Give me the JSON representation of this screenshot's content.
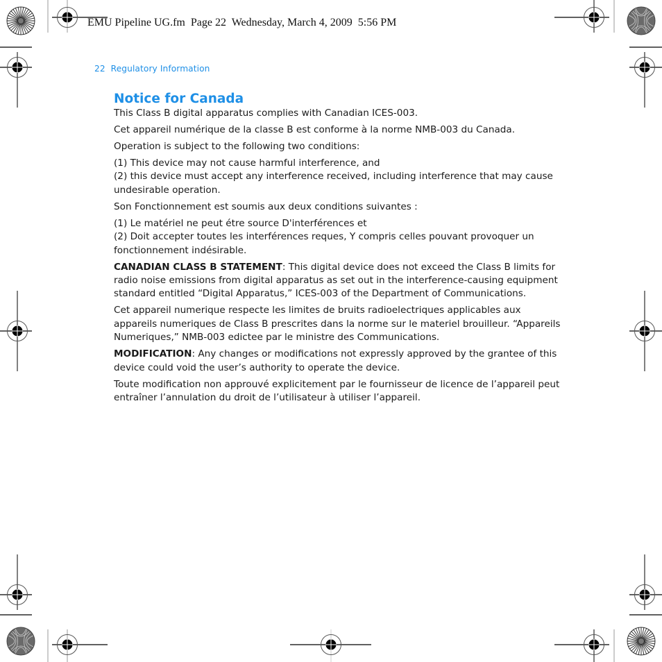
{
  "slug": {
    "text": "EMU Pipeline UG.fm  Page 22  Wednesday, March 4, 2009  5:56 PM"
  },
  "running_head": {
    "page_number": "22",
    "section": "Regulatory Information"
  },
  "section": {
    "title": "Notice for Canada",
    "title_color": "#1e8fe6",
    "paragraphs": [
      {
        "text": "This Class B digital apparatus complies with Canadian ICES-003."
      },
      {
        "text": "Cet appareil numérique de la classe B est conforme à la norme NMB-003 du Canada."
      },
      {
        "text": "Operation is subject to the following two conditions:"
      },
      {
        "line1": "(1) This device may not cause harmful interference, and",
        "line2": "(2) this device must accept any interference received, including interference that may cause undesirable operation."
      },
      {
        "text": "Son Fonctionnement  est  soumis aux deux conditions suivantes :"
      },
      {
        "line1": "(1) Le matériel ne peut étre source D'interférences et",
        "line2": "(2) Doit accepter toutes les interférences reques, Y compris celles pouvant provoquer un fonctionnement indésirable."
      },
      {
        "lead": "CANADIAN CLASS B STATEMENT",
        "text": ": This digital device does not exceed the Class B limits for radio noise emissions from digital apparatus as set out in the interference-causing equipment standard entitled “Digital Apparatus,” ICES-003 of the Department of Communications."
      },
      {
        "text": "Cet appareil numerique respecte les limites de bruits radioelectriques applicables aux appareils numeriques de Class B prescrites dans la norme sur le materiel brouilleur. “Appareils Numeriques,” NMB-003 edictee par le ministre des Communications."
      },
      {
        "lead": "MODIFICATION",
        "text": ": Any changes or modifications not expressly approved by the grantee of this device could void the user’s authority to operate the device."
      },
      {
        "text": "Toute modification non approuvé explicitement par le fournisseur de licence de l’appareil peut entraîner l’annulation du droit de l’utilisateur à utiliser l’appareil."
      }
    ]
  },
  "print_marks": {
    "registration_mark_icon": "crosshair-circle-icon",
    "starburst_icon": "starburst-target-icon",
    "moire_icon": "moire-disc-icon"
  }
}
